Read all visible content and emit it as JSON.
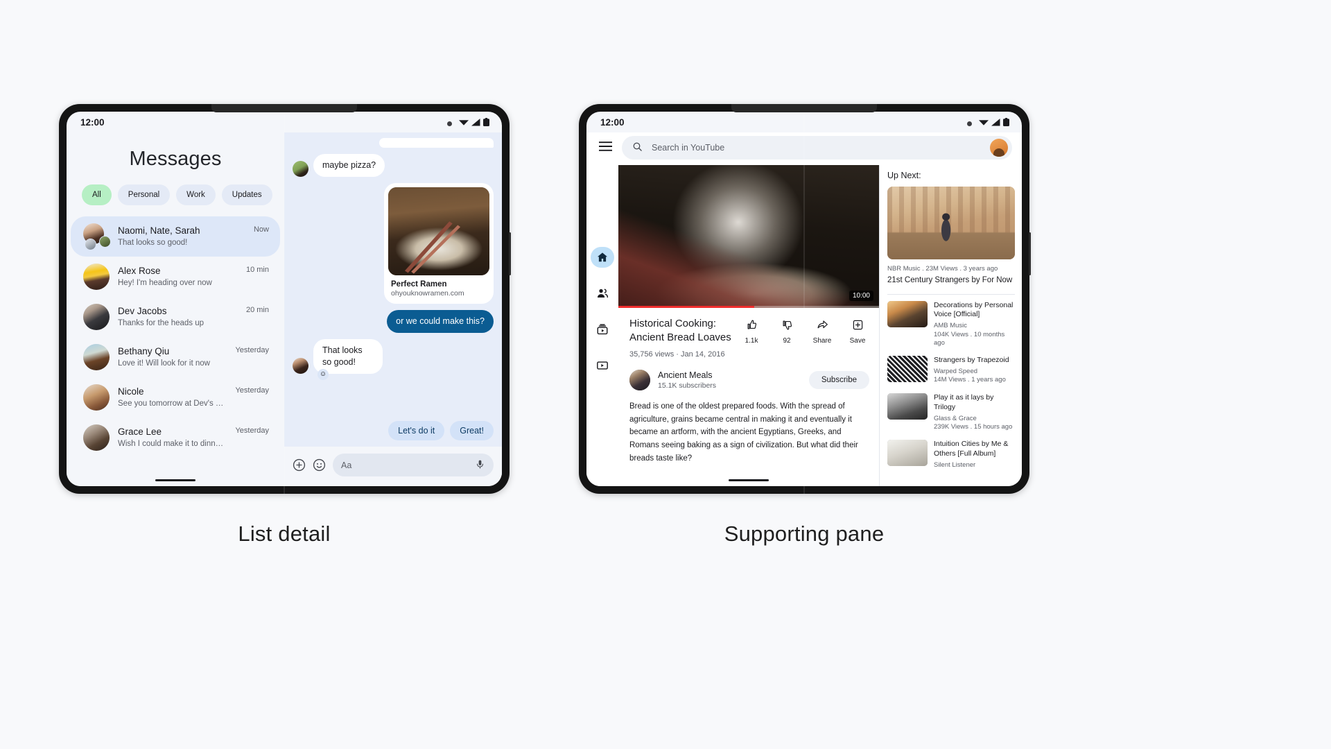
{
  "captions": {
    "left": "List detail",
    "right": "Supporting pane"
  },
  "messages": {
    "statusbar": {
      "time": "12:00"
    },
    "title": "Messages",
    "chips": [
      {
        "label": "All",
        "selected": true
      },
      {
        "label": "Personal",
        "selected": false
      },
      {
        "label": "Work",
        "selected": false
      },
      {
        "label": "Updates",
        "selected": false
      }
    ],
    "conversations": [
      {
        "name": "Naomi, Nate, Sarah",
        "snippet": "That looks so good!",
        "time": "Now",
        "active": true
      },
      {
        "name": "Alex Rose",
        "snippet": "Hey! I'm heading over now",
        "time": "10 min",
        "active": false
      },
      {
        "name": "Dev Jacobs",
        "snippet": "Thanks for the heads up",
        "time": "20 min",
        "active": false
      },
      {
        "name": "Bethany Qiu",
        "snippet": "Love it! Will look for it now",
        "time": "Yesterday",
        "active": false
      },
      {
        "name": "Nicole",
        "snippet": "See you tomorrow at Dev's show?",
        "time": "Yesterday",
        "active": false
      },
      {
        "name": "Grace Lee",
        "snippet": "Wish I could make it to dinner club",
        "time": "Yesterday",
        "active": false
      }
    ],
    "thread": [
      {
        "kind": "partial",
        "direction": "out"
      },
      {
        "kind": "text",
        "direction": "in",
        "text": "maybe pizza?"
      },
      {
        "kind": "card",
        "direction": "out",
        "card_title": "Perfect Ramen",
        "card_url": "ohyouknowramen.com"
      },
      {
        "kind": "text",
        "direction": "out",
        "text": "or we could make this?"
      },
      {
        "kind": "text",
        "direction": "in",
        "text": "That looks so good!",
        "reaction": "☺"
      }
    ],
    "suggestions": [
      "Let's do it",
      "Great!"
    ],
    "composer": {
      "placeholder": "Aa",
      "add_icon": "plus-circle-icon",
      "emoji_icon": "emoji-icon",
      "mic_icon": "microphone-icon"
    }
  },
  "youtube": {
    "statusbar": {
      "time": "12:00"
    },
    "search": {
      "placeholder": "Search in YouTube",
      "icon": "search-icon"
    },
    "menu_icon": "hamburger-menu-icon",
    "rail": [
      {
        "name": "home",
        "icon": "home-icon",
        "active": true
      },
      {
        "name": "shared",
        "icon": "people-icon",
        "active": false
      },
      {
        "name": "subscriptions",
        "icon": "subscriptions-icon",
        "active": false
      },
      {
        "name": "library",
        "icon": "library-icon",
        "active": false
      }
    ],
    "player": {
      "duration": "10:00",
      "progress_percent": 52
    },
    "video": {
      "title": "Historical Cooking: Ancient Bread Loaves",
      "meta": "35,756 views · Jan 14, 2016"
    },
    "actions": [
      {
        "label": "1.1k",
        "icon": "thumbs-up-icon"
      },
      {
        "label": "92",
        "icon": "thumbs-down-icon"
      },
      {
        "label": "Share",
        "icon": "share-icon"
      },
      {
        "label": "Save",
        "icon": "save-icon"
      }
    ],
    "channel": {
      "name": "Ancient Meals",
      "subscribers": "15.1K subscribers",
      "subscribe_label": "Subscribe"
    },
    "description": "Bread is one of the oldest prepared foods. With the spread of agriculture, grains became central in making it and eventually it became an artform, with the ancient Egyptians, Greeks, and Romans seeing baking as a sign of civilization. But what did their breads taste like?",
    "upnext": {
      "heading": "Up Next:",
      "hero": {
        "meta": "NBR Music . 23M Views . 3 years ago",
        "title": "21st Century Strangers by For Now"
      },
      "items": [
        {
          "title": "Decorations by Personal Voice [Official]",
          "by": "AMB Music",
          "stats": "104K Views . 10 months ago"
        },
        {
          "title": "Strangers by Trapezoid",
          "by": "Warped Speed",
          "stats": "14M Views . 1 years ago"
        },
        {
          "title": "Play it as it lays by Trilogy",
          "by": "Glass & Grace",
          "stats": "239K Views . 15 hours ago"
        },
        {
          "title": "Intuition Cities by Me & Others [Full Album]",
          "by": "Silent Listener",
          "stats": ""
        }
      ]
    }
  }
}
